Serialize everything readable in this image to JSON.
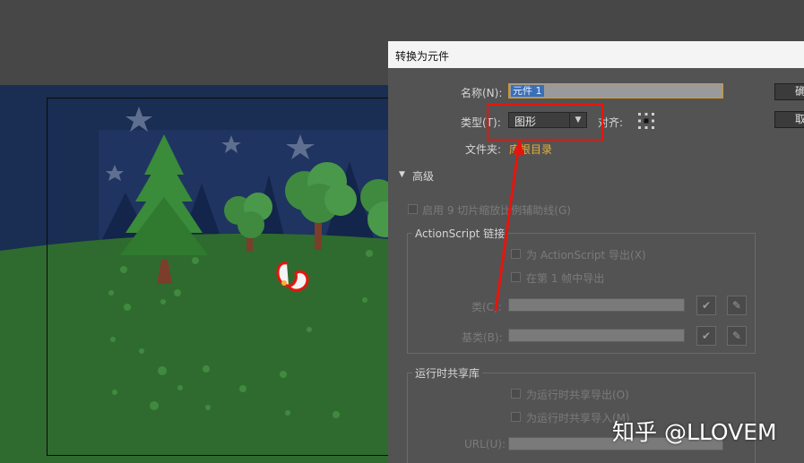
{
  "dialog": {
    "title": "转换为元件",
    "name_label": "名称(N):",
    "name_value": "元件 1",
    "type_label": "类型(T):",
    "type_value": "图形",
    "align_label": "对齐:",
    "folder_label": "文件夹:",
    "folder_value": "库根目录",
    "ok_label": "确定",
    "cancel_label": "取消",
    "advanced_label": "高级",
    "enable_9slice": "启用 9 切片缩放比例辅助线(G)",
    "actionscript_group": "ActionScript 链接",
    "export_for_as": "为 ActionScript 导出(X)",
    "export_frame1": "在第 1 帧中导出",
    "class_label": "类(C):",
    "base_class_label": "基类(B):",
    "runtime_group": "运行时共享库",
    "runtime_export": "为运行时共享导出(O)",
    "runtime_import": "为运行时共享导入(M)",
    "url_label": "URL(U):"
  },
  "watermark": "知乎 @LLOVEM",
  "colors": {
    "annotation_red": "#e8140c",
    "folder_link": "#e2b13c",
    "night_sky": "#1a2d52",
    "grass": "#2f6b2f"
  },
  "icons": {
    "dropdown": "chevron-down-icon",
    "align": "registration-grid-icon",
    "check": "checkmark-icon",
    "pencil": "pencil-icon"
  }
}
